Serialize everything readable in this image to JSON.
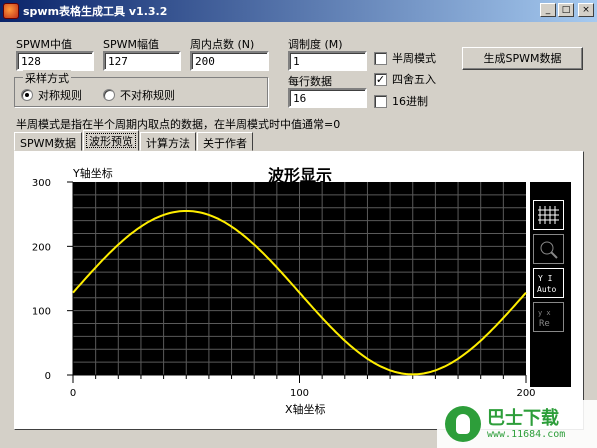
{
  "window": {
    "title": "spwm表格生成工具 v1.3.2",
    "minimize": "_",
    "maximize": "□",
    "close": "×"
  },
  "form": {
    "center_label": "SPWM中值",
    "center_value": "128",
    "amp_label": "SPWM幅值",
    "amp_value": "127",
    "points_label": "周内点数 (N)",
    "points_value": "200",
    "mod_label": "调制度 (M)",
    "mod_value": "1",
    "perline_label": "每行数据",
    "perline_value": "16"
  },
  "sampling": {
    "legend": "采样方式",
    "sym": "对称规则",
    "asym": "不对称规则",
    "selected": "sym"
  },
  "options": {
    "half": {
      "label": "半周模式",
      "checked": false
    },
    "round": {
      "label": "四舍五入",
      "checked": true
    },
    "hex": {
      "label": "16进制",
      "checked": false
    }
  },
  "generate_label": "生成SPWM数据",
  "hint": "半周模式是指在半个周期内取点的数据，在半周模式时中值通常=0",
  "tabs": [
    {
      "label": "SPWM数据"
    },
    {
      "label": "波形预览"
    },
    {
      "label": "计算方法"
    },
    {
      "label": "关于作者"
    }
  ],
  "active_tab": 1,
  "tool_icons": [
    "grid-icon",
    "zoom-icon",
    "y-auto-icon",
    "y-reset-icon"
  ],
  "watermark": {
    "title": "巴士下载",
    "sub": "www.11684.com"
  },
  "colors": {
    "plot_bg": "#000000",
    "wave": "#ffee00",
    "grid": "#5a5a5a"
  },
  "chart_data": {
    "type": "line",
    "title": "波形显示",
    "xlabel": "X轴坐标",
    "ylabel": "Y轴坐标",
    "xlim": [
      0,
      200
    ],
    "ylim": [
      0,
      300
    ],
    "xticks": [
      "0",
      "100",
      "200"
    ],
    "yticks": [
      "0",
      "100",
      "200",
      "300"
    ],
    "grid": true,
    "series": [
      {
        "function": "sine",
        "offset": 128,
        "amplitude": 127,
        "period": 200,
        "x_start": 0,
        "x_end": 200
      }
    ]
  }
}
